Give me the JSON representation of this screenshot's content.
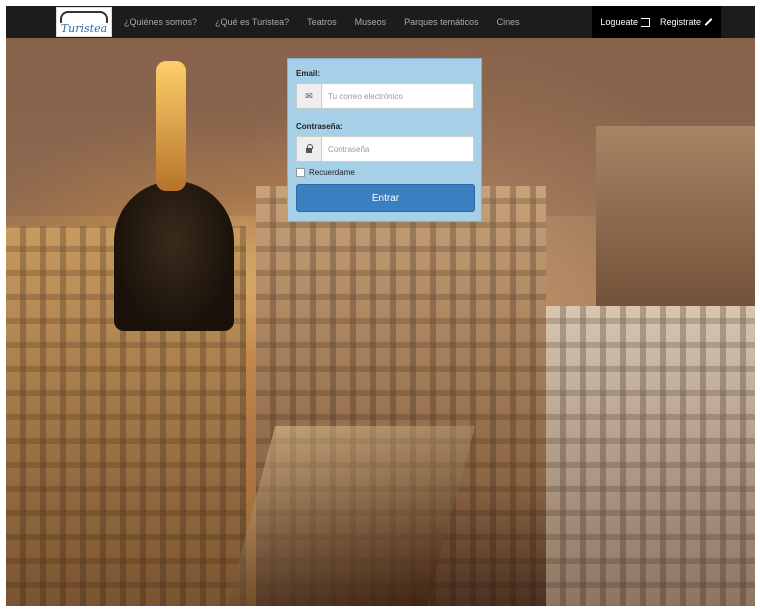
{
  "navbar": {
    "logo_text": "Turistea",
    "items": [
      {
        "label": "¿Quiénes somos?"
      },
      {
        "label": "¿Qué es Turistea?"
      },
      {
        "label": "Teatros"
      },
      {
        "label": "Museos"
      },
      {
        "label": "Parques temáticos"
      },
      {
        "label": "Cines"
      }
    ],
    "login_label": "Logueate",
    "register_label": "Registrate"
  },
  "login": {
    "email_label": "Email:",
    "email_placeholder": "Tu correo electrónico",
    "email_value": "",
    "password_label": "Contraseña:",
    "password_placeholder": "Contraseña",
    "password_value": "",
    "remember_label": "Recuerdame",
    "remember_checked": false,
    "submit_label": "Entrar"
  },
  "icons": {
    "email": "envelope-icon",
    "password": "lock-icon",
    "login": "sign-in-icon",
    "register": "pencil-icon"
  },
  "colors": {
    "navbar_bg": "#1c1c1c",
    "panel_bg": "#a5d0e8",
    "button_bg": "#3a7fbf"
  }
}
